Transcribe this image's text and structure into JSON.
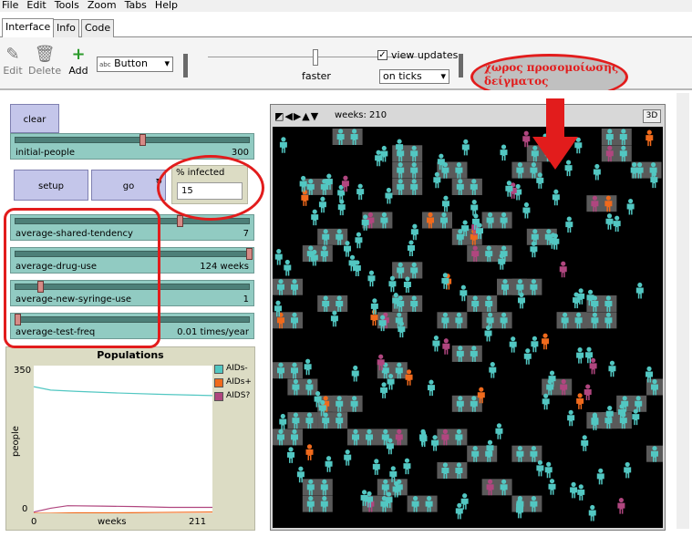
{
  "menu": [
    "File",
    "Edit",
    "Tools",
    "Zoom",
    "Tabs",
    "Help"
  ],
  "tabs": [
    "Interface",
    "Info",
    "Code"
  ],
  "toolbar": {
    "edit": "Edit",
    "delete": "Delete",
    "add": "Add",
    "widget_type": "Button",
    "speed_label": "faster",
    "view_updates_label": "view updates",
    "update_mode": "on ticks"
  },
  "widgets": {
    "clear_button": "clear",
    "setup_button": "setup",
    "go_button": "go",
    "initial_people": {
      "label": "initial-people",
      "value": "300",
      "fraction": 0.54
    },
    "monitor": {
      "label": "% infected",
      "value": "15"
    },
    "sliders": [
      {
        "label": "average-shared-tendency",
        "value": "7",
        "fraction": 0.7
      },
      {
        "label": "average-drug-use",
        "value": "124 weeks",
        "fraction": 1.0
      },
      {
        "label": "average-new-syringe-use",
        "value": "1",
        "fraction": 0.1
      },
      {
        "label": "average-test-freq",
        "value": "0.01 times/year",
        "fraction": 0.0
      }
    ]
  },
  "plot": {
    "title": "Populations",
    "ylabel": "people",
    "xlabel": "weeks",
    "y_max": "350",
    "y_min": "0",
    "x_min": "0",
    "x_max": "211",
    "legend": [
      {
        "name": "AIDs-",
        "color": "#52c7c2"
      },
      {
        "name": "AIDs+",
        "color": "#f06a1c"
      },
      {
        "name": "AIDS?",
        "color": "#b0467f"
      }
    ]
  },
  "chart_data": {
    "type": "line",
    "title": "Populations",
    "xlabel": "weeks",
    "ylabel": "people",
    "xlim": [
      0,
      211
    ],
    "ylim": [
      0,
      350
    ],
    "series": [
      {
        "name": "AIDs-",
        "color": "#52c7c2",
        "x": [
          0,
          10,
          20,
          50,
          100,
          150,
          211
        ],
        "values": [
          300,
          296,
          292,
          289,
          285,
          282,
          279
        ]
      },
      {
        "name": "AIDs+",
        "color": "#f06a1c",
        "x": [
          0,
          20,
          50,
          100,
          150,
          211
        ],
        "values": [
          0,
          0,
          1,
          1,
          2,
          3
        ]
      },
      {
        "name": "AIDS?",
        "color": "#b0467f",
        "x": [
          0,
          20,
          40,
          80,
          120,
          160,
          211
        ],
        "values": [
          3,
          12,
          18,
          17,
          16,
          14,
          14
        ]
      }
    ]
  },
  "world": {
    "ticks_label": "weeks: 210",
    "three_d_button": "3D"
  },
  "annotation": {
    "callout_line1": "χωρος προσομοίωσης",
    "callout_line2": "δείγματος"
  },
  "colors": {
    "healthy": "#52c7c2",
    "infected": "#f06a1c",
    "unknown": "#b0467f",
    "couple_patch": "#5a5a5a",
    "highlight": "#e21c1c"
  }
}
